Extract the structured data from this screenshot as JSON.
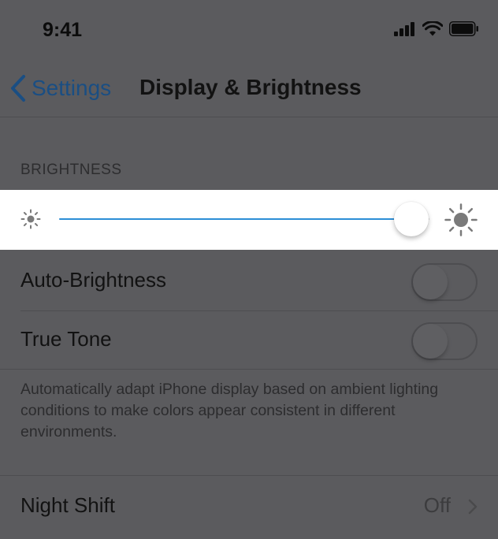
{
  "status_bar": {
    "time": "9:41"
  },
  "nav": {
    "back_label": "Settings",
    "title": "Display & Brightness"
  },
  "brightness": {
    "section_header": "BRIGHTNESS",
    "level_fraction": 0.95
  },
  "settings": {
    "auto_brightness": {
      "label": "Auto-Brightness",
      "on": false
    },
    "true_tone": {
      "label": "True Tone",
      "on": false
    },
    "true_tone_footer": "Automatically adapt iPhone display based on ambient lighting conditions to make colors appear consistent in different environments.",
    "night_shift": {
      "label": "Night Shift",
      "value": "Off"
    }
  },
  "colors": {
    "background": "#5b5b5e",
    "slider_fill": "#2c8ed6",
    "link": "#1a4e83"
  }
}
